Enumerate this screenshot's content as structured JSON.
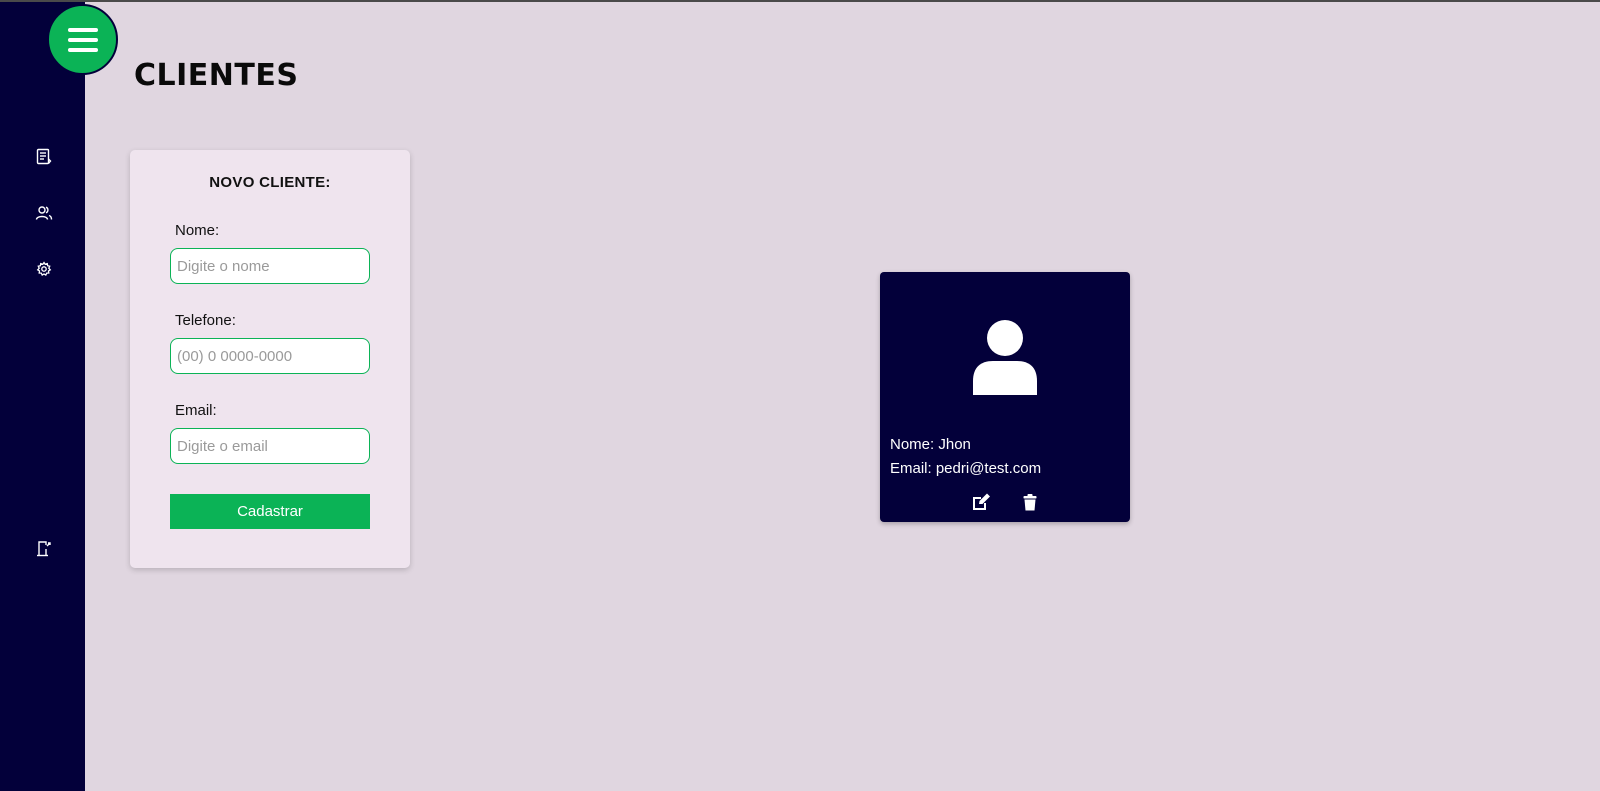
{
  "sidebar": {
    "menu_icon": "hamburger-menu-icon",
    "items": [
      {
        "icon": "document-list-icon"
      },
      {
        "icon": "users-icon"
      },
      {
        "icon": "gear-icon"
      }
    ],
    "logout_icon": "logout-door-icon"
  },
  "header": {
    "title": "CLIENTES"
  },
  "form": {
    "title": "NOVO CLIENTE:",
    "name_label": "Nome:",
    "name_placeholder": "Digite o nome",
    "phone_label": "Telefone:",
    "phone_placeholder": "(00) 0 0000-0000",
    "email_label": "Email:",
    "email_placeholder": "Digite o email",
    "submit_label": "Cadastrar"
  },
  "clients": [
    {
      "name_line": "Nome: Jhon",
      "email_line": "Email: pedri@test.com",
      "avatar_icon": "user-avatar-icon",
      "edit_icon": "edit-icon",
      "delete_icon": "trash-icon"
    }
  ],
  "colors": {
    "sidebar": "#03003a",
    "accent": "#0bb356",
    "background": "#e0d6e0",
    "form_card": "#efe4ee",
    "client_card": "#03003a"
  }
}
